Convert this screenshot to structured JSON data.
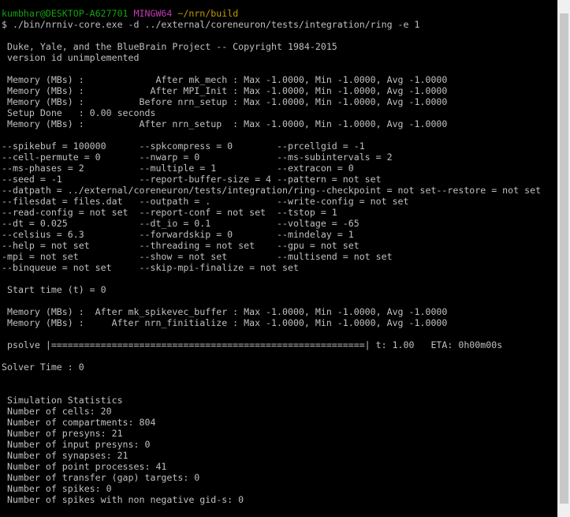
{
  "prompt": {
    "user_host": "kumbhar@DESKTOP-A627701",
    "env": "MINGW64",
    "path": "~/nrn/build"
  },
  "lines": [
    "$ ./bin/nrniv-core.exe -d ../external/coreneuron/tests/integration/ring -e 1",
    "",
    " Duke, Yale, and the BlueBrain Project -- Copyright 1984-2015",
    " version id unimplemented",
    "",
    " Memory (MBs) :             After mk_mech : Max -1.0000, Min -1.0000, Avg -1.0000",
    " Memory (MBs) :            After MPI_Init : Max -1.0000, Min -1.0000, Avg -1.0000",
    " Memory (MBs) :          Before nrn_setup : Max -1.0000, Min -1.0000, Avg -1.0000",
    " Setup Done   : 0.00 seconds",
    " Memory (MBs) :          After nrn_setup  : Max -1.0000, Min -1.0000, Avg -1.0000",
    "",
    "--spikebuf = 100000      --spkcompress = 0        --prcellgid = -1",
    "--cell-permute = 0       --nwarp = 0              --ms-subintervals = 2",
    "--ms-phases = 2          --multiple = 1           --extracon = 0",
    "--seed = -1              --report-buffer-size = 4 --pattern = not set",
    "--datpath = ../external/coreneuron/tests/integration/ring--checkpoint = not set--restore = not set",
    "--filesdat = files.dat   --outpath = .            --write-config = not set",
    "--read-config = not set  --report-conf = not set  --tstop = 1",
    "--dt = 0.025             --dt_io = 0.1            --voltage = -65",
    "--celsius = 6.3          --forwardskip = 0        --mindelay = 1",
    "--help = not set         --threading = not set    --gpu = not set",
    "-mpi = not set           --show = not set         --multisend = not set",
    "--binqueue = not set     --skip-mpi-finalize = not set",
    "",
    " Start time (t) = 0",
    "",
    " Memory (MBs) :  After mk_spikevec_buffer : Max -1.0000, Min -1.0000, Avg -1.0000",
    " Memory (MBs) :     After nrn_finitialize : Max -1.0000, Min -1.0000, Avg -1.0000",
    "",
    " psolve |=========================================================| t: 1.00   ETA: 0h00m00s",
    "",
    "Solver Time : 0",
    "",
    "",
    " Simulation Statistics",
    " Number of cells: 20",
    " Number of compartments: 804",
    " Number of presyns: 21",
    " Number of input presyns: 0",
    " Number of synapses: 21",
    " Number of point processes: 41",
    " Number of transfer (gap) targets: 0",
    " Number of spikes: 0",
    " Number of spikes with non negative gid-s: 0"
  ],
  "colors": {
    "background": "#000000",
    "text": "#c0c0c0",
    "user_host": "#13a10e",
    "env": "#c239b3",
    "path": "#c19c00"
  }
}
